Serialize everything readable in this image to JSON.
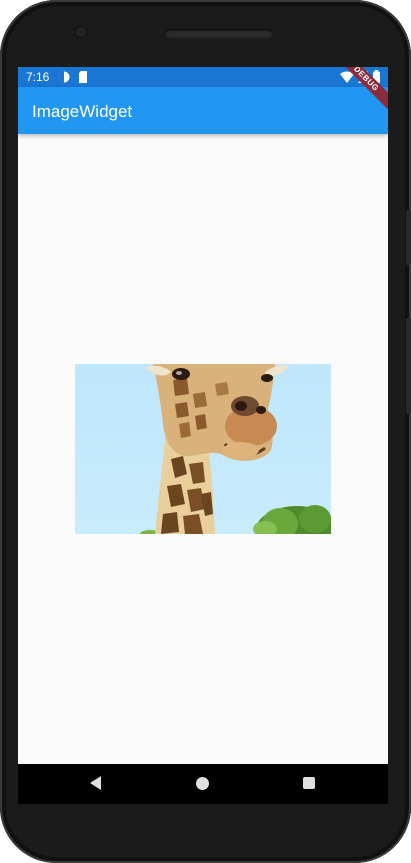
{
  "status_bar": {
    "time": "7:16",
    "icons": [
      "data-saver-icon",
      "sim-card-icon",
      "wifi-icon",
      "signal-icon",
      "battery-icon"
    ]
  },
  "app_bar": {
    "title": "ImageWidget",
    "color": "#2196f3"
  },
  "debug_banner": {
    "label": "DEBUG"
  },
  "content": {
    "image": {
      "subject": "giraffe"
    }
  },
  "nav_bar": {
    "icons": [
      "back-icon",
      "home-icon",
      "recent-apps-icon"
    ]
  }
}
